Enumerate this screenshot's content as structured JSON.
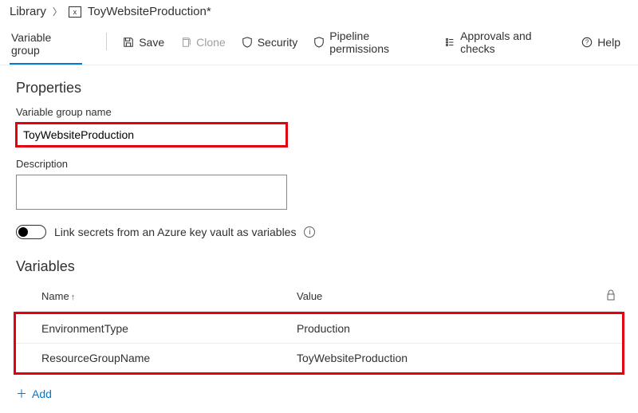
{
  "breadcrumb": {
    "root": "Library",
    "current": "ToyWebsiteProduction*"
  },
  "tabs": {
    "active": "Variable group"
  },
  "toolbar": {
    "save": "Save",
    "clone": "Clone",
    "security": "Security",
    "pipeline_permissions": "Pipeline permissions",
    "approvals_checks": "Approvals and checks",
    "help": "Help"
  },
  "properties": {
    "heading": "Properties",
    "name_label": "Variable group name",
    "name_value": "ToyWebsiteProduction",
    "description_label": "Description",
    "description_value": "",
    "keyvault_toggle": "Link secrets from an Azure key vault as variables"
  },
  "variables": {
    "heading": "Variables",
    "col_name": "Name",
    "col_value": "Value",
    "rows": [
      {
        "name": "EnvironmentType",
        "value": "Production"
      },
      {
        "name": "ResourceGroupName",
        "value": "ToyWebsiteProduction"
      }
    ],
    "add": "Add"
  }
}
